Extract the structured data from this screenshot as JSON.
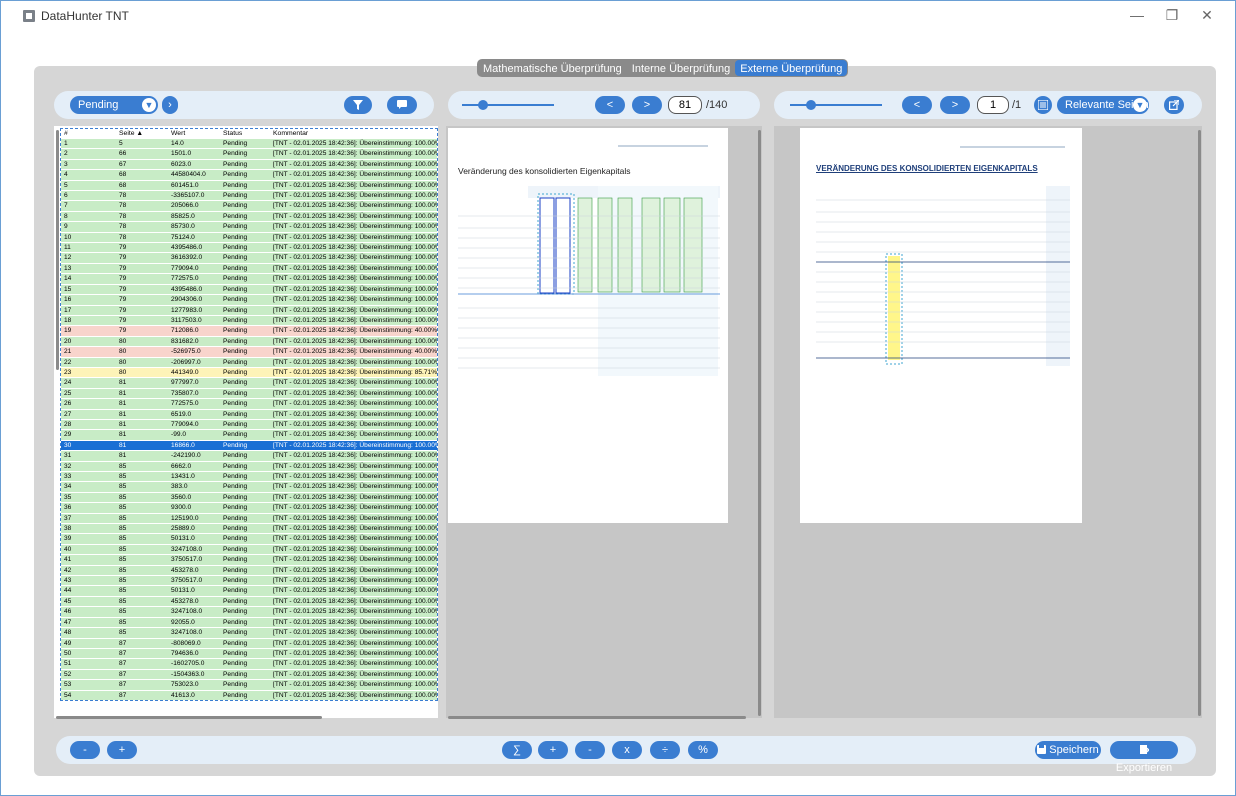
{
  "window": {
    "title": "DataHunter TNT",
    "minimize": "—",
    "restore": "❐",
    "close": "✕"
  },
  "tabs": [
    {
      "label": "Mathematische Überprüfung",
      "active": false
    },
    {
      "label": "Interne Überprüfung",
      "active": false
    },
    {
      "label": "Externe Überprüfung",
      "active": true
    }
  ],
  "left_toolbar": {
    "status_filter": "Pending",
    "dropdown_icon": "chevron-down-icon",
    "next_icon": "chevron-right-icon",
    "filter_icon": "filter-icon",
    "comment_icon": "comment-icon"
  },
  "table": {
    "columns": [
      "#",
      "Seite ▲",
      "Wert",
      "Status",
      "Kommentar"
    ],
    "rows": [
      [
        "1",
        "5",
        "14.0",
        "Pending",
        "[TNT - 02.01.2025 18:42:36]: Übereinstimmung: 100.00%",
        "ok"
      ],
      [
        "2",
        "66",
        "1501.0",
        "Pending",
        "[TNT - 02.01.2025 18:42:36]: Übereinstimmung: 100.00%",
        "ok"
      ],
      [
        "3",
        "67",
        "6023.0",
        "Pending",
        "[TNT - 02.01.2025 18:42:36]: Übereinstimmung: 100.00%",
        "ok"
      ],
      [
        "4",
        "68",
        "44580404.0",
        "Pending",
        "[TNT - 02.01.2025 18:42:36]: Übereinstimmung: 100.00%",
        "ok"
      ],
      [
        "5",
        "68",
        "601451.0",
        "Pending",
        "[TNT - 02.01.2025 18:42:36]: Übereinstimmung: 100.00%",
        "ok"
      ],
      [
        "6",
        "78",
        "-3365107.0",
        "Pending",
        "[TNT - 02.01.2025 18:42:36]: Übereinstimmung: 100.00%",
        "ok"
      ],
      [
        "7",
        "78",
        "205066.0",
        "Pending",
        "[TNT - 02.01.2025 18:42:36]: Übereinstimmung: 100.00%",
        "ok"
      ],
      [
        "8",
        "78",
        "85825.0",
        "Pending",
        "[TNT - 02.01.2025 18:42:36]: Übereinstimmung: 100.00%",
        "ok"
      ],
      [
        "9",
        "78",
        "85730.0",
        "Pending",
        "[TNT - 02.01.2025 18:42:36]: Übereinstimmung: 100.00%",
        "ok"
      ],
      [
        "10",
        "78",
        "75124.0",
        "Pending",
        "[TNT - 02.01.2025 18:42:36]: Übereinstimmung: 100.00%",
        "ok"
      ],
      [
        "11",
        "79",
        "4395486.0",
        "Pending",
        "[TNT - 02.01.2025 18:42:36]: Übereinstimmung: 100.00%",
        "ok"
      ],
      [
        "12",
        "79",
        "3616392.0",
        "Pending",
        "[TNT - 02.01.2025 18:42:36]: Übereinstimmung: 100.00%",
        "ok"
      ],
      [
        "13",
        "79",
        "779094.0",
        "Pending",
        "[TNT - 02.01.2025 18:42:36]: Übereinstimmung: 100.00%",
        "ok"
      ],
      [
        "14",
        "79",
        "772575.0",
        "Pending",
        "[TNT - 02.01.2025 18:42:36]: Übereinstimmung: 100.00%",
        "ok"
      ],
      [
        "15",
        "79",
        "4395486.0",
        "Pending",
        "[TNT - 02.01.2025 18:42:36]: Übereinstimmung: 100.00%",
        "ok"
      ],
      [
        "16",
        "79",
        "2904306.0",
        "Pending",
        "[TNT - 02.01.2025 18:42:36]: Übereinstimmung: 100.00%",
        "ok"
      ],
      [
        "17",
        "79",
        "1277983.0",
        "Pending",
        "[TNT - 02.01.2025 18:42:36]: Übereinstimmung: 100.00%",
        "ok"
      ],
      [
        "18",
        "79",
        "3117503.0",
        "Pending",
        "[TNT - 02.01.2025 18:42:36]: Übereinstimmung: 100.00%",
        "ok"
      ],
      [
        "19",
        "79",
        "712086.0",
        "Pending",
        "[TNT - 02.01.2025 18:42:36]: Übereinstimmung: 40.00%",
        "bad"
      ],
      [
        "20",
        "80",
        "831682.0",
        "Pending",
        "[TNT - 02.01.2025 18:42:36]: Übereinstimmung: 100.00%",
        "ok"
      ],
      [
        "21",
        "80",
        "-526975.0",
        "Pending",
        "[TNT - 02.01.2025 18:42:36]: Übereinstimmung: 40.00%",
        "bad"
      ],
      [
        "22",
        "80",
        "-206997.0",
        "Pending",
        "[TNT - 02.01.2025 18:42:36]: Übereinstimmung: 100.00%",
        "ok"
      ],
      [
        "23",
        "80",
        "441349.0",
        "Pending",
        "[TNT - 02.01.2025 18:42:36]: Übereinstimmung: 85.71%",
        "warn"
      ],
      [
        "24",
        "81",
        "977997.0",
        "Pending",
        "[TNT - 02.01.2025 18:42:36]: Übereinstimmung: 100.00%",
        "ok"
      ],
      [
        "25",
        "81",
        "735807.0",
        "Pending",
        "[TNT - 02.01.2025 18:42:36]: Übereinstimmung: 100.00%",
        "ok"
      ],
      [
        "26",
        "81",
        "772575.0",
        "Pending",
        "[TNT - 02.01.2025 18:42:36]: Übereinstimmung: 100.00%",
        "ok"
      ],
      [
        "27",
        "81",
        "6519.0",
        "Pending",
        "[TNT - 02.01.2025 18:42:36]: Übereinstimmung: 100.00%",
        "ok"
      ],
      [
        "28",
        "81",
        "779094.0",
        "Pending",
        "[TNT - 02.01.2025 18:42:36]: Übereinstimmung: 100.00%",
        "ok"
      ],
      [
        "29",
        "81",
        "-99.0",
        "Pending",
        "[TNT - 02.01.2025 18:42:36]: Übereinstimmung: 100.00%",
        "ok"
      ],
      [
        "30",
        "81",
        "16866.0",
        "Pending",
        "[TNT - 02.01.2025 18:42:36]: Übereinstimmung: 100.00%",
        "sel"
      ],
      [
        "31",
        "81",
        "-242190.0",
        "Pending",
        "[TNT - 02.01.2025 18:42:36]: Übereinstimmung: 100.00%",
        "ok"
      ],
      [
        "32",
        "85",
        "6662.0",
        "Pending",
        "[TNT - 02.01.2025 18:42:36]: Übereinstimmung: 100.00%",
        "ok"
      ],
      [
        "33",
        "85",
        "13431.0",
        "Pending",
        "[TNT - 02.01.2025 18:42:36]: Übereinstimmung: 100.00%",
        "ok"
      ],
      [
        "34",
        "85",
        "383.0",
        "Pending",
        "[TNT - 02.01.2025 18:42:36]: Übereinstimmung: 100.00%",
        "ok"
      ],
      [
        "35",
        "85",
        "3560.0",
        "Pending",
        "[TNT - 02.01.2025 18:42:36]: Übereinstimmung: 100.00%",
        "ok"
      ],
      [
        "36",
        "85",
        "9300.0",
        "Pending",
        "[TNT - 02.01.2025 18:42:36]: Übereinstimmung: 100.00%",
        "ok"
      ],
      [
        "37",
        "85",
        "125190.0",
        "Pending",
        "[TNT - 02.01.2025 18:42:36]: Übereinstimmung: 100.00%",
        "ok"
      ],
      [
        "38",
        "85",
        "25889.0",
        "Pending",
        "[TNT - 02.01.2025 18:42:36]: Übereinstimmung: 100.00%",
        "ok"
      ],
      [
        "39",
        "85",
        "50131.0",
        "Pending",
        "[TNT - 02.01.2025 18:42:36]: Übereinstimmung: 100.00%",
        "ok"
      ],
      [
        "40",
        "85",
        "3247108.0",
        "Pending",
        "[TNT - 02.01.2025 18:42:36]: Übereinstimmung: 100.00%",
        "ok"
      ],
      [
        "41",
        "85",
        "3750517.0",
        "Pending",
        "[TNT - 02.01.2025 18:42:36]: Übereinstimmung: 100.00%",
        "ok"
      ],
      [
        "42",
        "85",
        "453278.0",
        "Pending",
        "[TNT - 02.01.2025 18:42:36]: Übereinstimmung: 100.00%",
        "ok"
      ],
      [
        "43",
        "85",
        "3750517.0",
        "Pending",
        "[TNT - 02.01.2025 18:42:36]: Übereinstimmung: 100.00%",
        "ok"
      ],
      [
        "44",
        "85",
        "50131.0",
        "Pending",
        "[TNT - 02.01.2025 18:42:36]: Übereinstimmung: 100.00%",
        "ok"
      ],
      [
        "45",
        "85",
        "453278.0",
        "Pending",
        "[TNT - 02.01.2025 18:42:36]: Übereinstimmung: 100.00%",
        "ok"
      ],
      [
        "46",
        "85",
        "3247108.0",
        "Pending",
        "[TNT - 02.01.2025 18:42:36]: Übereinstimmung: 100.00%",
        "ok"
      ],
      [
        "47",
        "85",
        "92055.0",
        "Pending",
        "[TNT - 02.01.2025 18:42:36]: Übereinstimmung: 100.00%",
        "ok"
      ],
      [
        "48",
        "85",
        "3247108.0",
        "Pending",
        "[TNT - 02.01.2025 18:42:36]: Übereinstimmung: 100.00%",
        "ok"
      ],
      [
        "49",
        "87",
        "-808069.0",
        "Pending",
        "[TNT - 02.01.2025 18:42:36]: Übereinstimmung: 100.00%",
        "ok"
      ],
      [
        "50",
        "87",
        "794636.0",
        "Pending",
        "[TNT - 02.01.2025 18:42:36]: Übereinstimmung: 100.00%",
        "ok"
      ],
      [
        "51",
        "87",
        "-1602705.0",
        "Pending",
        "[TNT - 02.01.2025 18:42:36]: Übereinstimmung: 100.00%",
        "ok"
      ],
      [
        "52",
        "87",
        "-1504363.0",
        "Pending",
        "[TNT - 02.01.2025 18:42:36]: Übereinstimmung: 100.00%",
        "ok"
      ],
      [
        "53",
        "87",
        "753023.0",
        "Pending",
        "[TNT - 02.01.2025 18:42:36]: Übereinstimmung: 100.00%",
        "ok"
      ],
      [
        "54",
        "87",
        "41613.0",
        "Pending",
        "[TNT - 02.01.2025 18:42:36]: Übereinstimmung: 100.00%",
        "ok"
      ]
    ]
  },
  "middle_viewer": {
    "prev": "<",
    "next": ">",
    "current_page": "81",
    "total": "/140",
    "doc_title": "Veränderung des konsolidierten Eigenkapitals"
  },
  "right_viewer": {
    "prev": "<",
    "next": ">",
    "current_page": "1",
    "total": "/1",
    "filter": "Relevante Seiten",
    "list_icon": "list-icon",
    "open_icon": "external-link-icon",
    "doc_title": "VERÄNDERUNG DES KONSOLIDIERTEN EIGENKAPITALS"
  },
  "bottom_toolbar": {
    "zoom_out": "-",
    "zoom_in": "+",
    "ops": [
      "∑",
      "+",
      "-",
      "x",
      "÷",
      "%"
    ],
    "save_label": "Speichern",
    "export_label": "Exportieren"
  },
  "colors": {
    "accent": "#3a7dd1",
    "ok_row": "#c8ecc6",
    "bad_row": "#f8d4cc",
    "warn_row": "#fdf3b8",
    "selected_row": "#1a6fd4"
  }
}
